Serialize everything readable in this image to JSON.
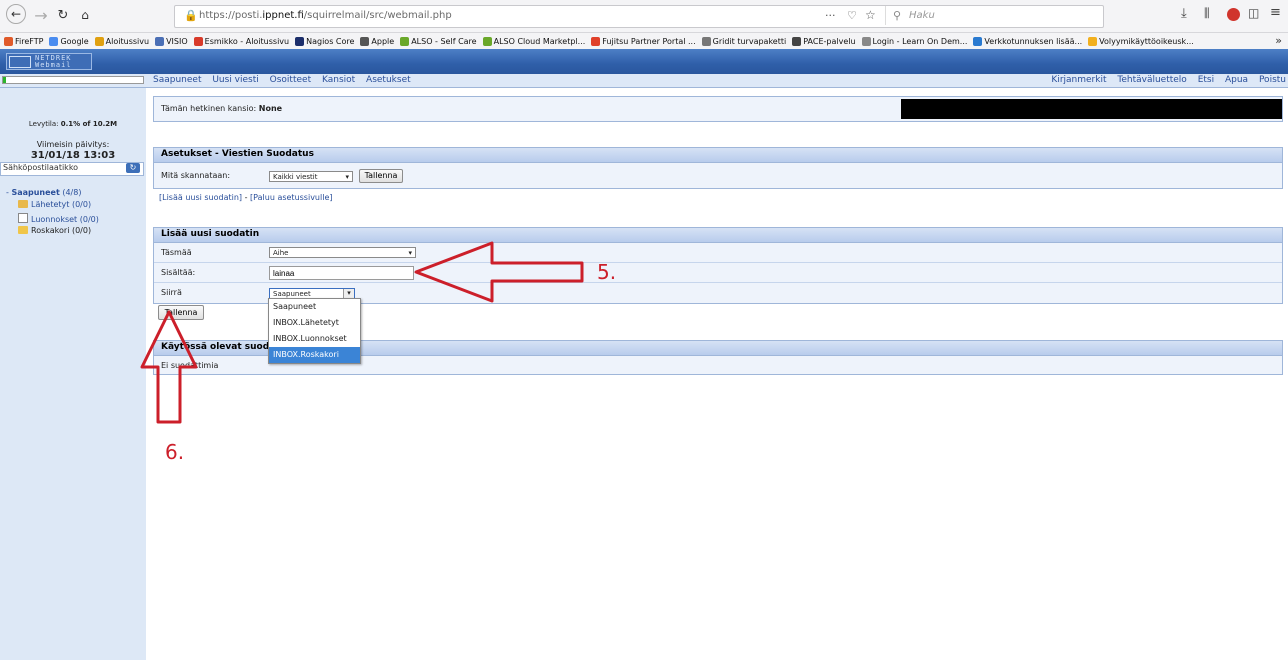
{
  "browser": {
    "url_prefix": "https://posti.",
    "url_domain": "ippnet.fi",
    "url_path": "/squirrelmail/src/webmail.php",
    "search_placeholder": "Haku",
    "bookmarks": [
      {
        "label": "FireFTP",
        "color": "#e05a2a"
      },
      {
        "label": "Google",
        "color": "#4a8cf0"
      },
      {
        "label": "Aloitussivu",
        "color": "#e0a010"
      },
      {
        "label": "VISIO",
        "color": "#4b6fb5"
      },
      {
        "label": "Esmikko - Aloitussivu",
        "color": "#d83a2a"
      },
      {
        "label": "Nagios Core",
        "color": "#1c2e6b"
      },
      {
        "label": "Apple",
        "color": "#555555"
      },
      {
        "label": "ALSO - Self Care",
        "color": "#6aa82a"
      },
      {
        "label": "ALSO Cloud Marketpl...",
        "color": "#6aa82a"
      },
      {
        "label": "Fujitsu Partner Portal ...",
        "color": "#e0402a"
      },
      {
        "label": "Gridit turvapaketti",
        "color": "#777777"
      },
      {
        "label": "PACE-palvelu",
        "color": "#444444"
      },
      {
        "label": "Login - Learn On Dem...",
        "color": "#888888"
      },
      {
        "label": "Verkkotunnuksen lisää...",
        "color": "#2a7ad0"
      },
      {
        "label": "Volyymikäyttöoikeusk...",
        "color": "#f2b01e"
      }
    ]
  },
  "header": {
    "logo_line1": "NETDREK",
    "logo_line2": "Webmail"
  },
  "menu": {
    "left": [
      "Saapuneet",
      "Uusi viesti",
      "Osoitteet",
      "Kansiot",
      "Asetukset"
    ],
    "right": [
      "Kirjanmerkit",
      "Tehtäväluettelo",
      "Etsi",
      "Apua",
      "Poistu"
    ],
    "progress_fraction": 0.02
  },
  "sidebar": {
    "quota_label": "Levytila: ",
    "quota_value": "0.1% of 10.2M",
    "last_update_label": "Viimeisin päivitys:",
    "last_update_value": "31/01/18 13:03",
    "folder_header": "Sähköpostilaatikko",
    "folders": [
      {
        "prefix": "- ",
        "name": "Saapuneet",
        "count": " (4/8)",
        "bold": true,
        "icon": ""
      },
      {
        "name": "Lähetetyt",
        "count": " (0/0)",
        "icon": "sent-folder-icon"
      },
      {
        "name": "Luonnokset",
        "count": " (0/0)",
        "icon": "drafts-folder-icon"
      },
      {
        "name": "Roskakori",
        "count": " (0/0)",
        "icon": "trash-folder-icon"
      }
    ]
  },
  "main": {
    "current_folder_label": "Tämän hetkinen kansio: ",
    "current_folder_value": "None",
    "settings_title": "Asetukset - Viestien Suodatus",
    "scan_label": "Mitä skannataan:",
    "scan_value": "Kaikki viestit",
    "save_label": "Tallenna",
    "add_filter_link": "[Lisää uusi suodatin]",
    "separator": " - ",
    "back_link": "[Paluu asetussivulle]",
    "new_filter_title": "Lisää uusi suodatin",
    "match_label": "Täsmää",
    "match_value": "Aihe",
    "contains_label": "Sisältää:",
    "contains_value": "lainaa",
    "move_label": "Siirrä",
    "move_value": "Saapuneet",
    "move_options": [
      "Saapuneet",
      "INBOX.Lähetetyt",
      "INBOX.Luonnokset",
      "INBOX.Roskakori"
    ],
    "move_highlighted": "INBOX.Roskakori",
    "save_filter_label": "Tallenna",
    "active_filters_title": "Käytössä olevat suodattimet",
    "no_filters": "Ei suodattimia"
  },
  "annotations": {
    "step5": "5.",
    "step6": "6.",
    "color": "#cc1f2a"
  }
}
